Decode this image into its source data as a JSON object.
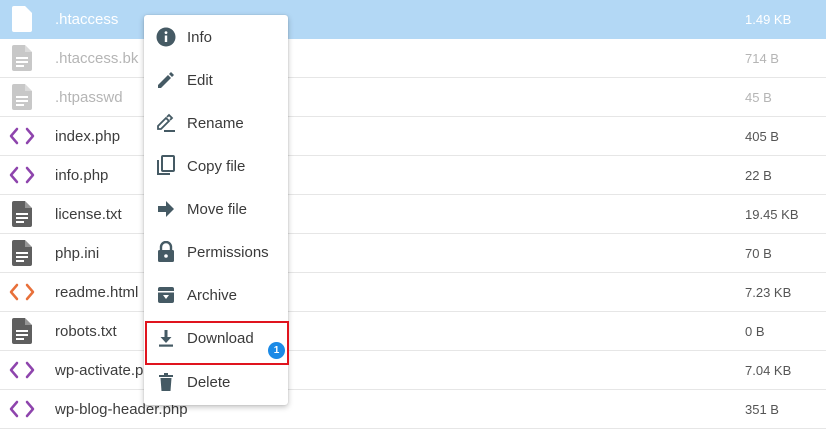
{
  "files": [
    {
      "name": ".htaccess",
      "size": "1.49 KB",
      "icon": "document-icon",
      "state": "selected"
    },
    {
      "name": ".htaccess.bk",
      "size": "714 B",
      "icon": "document-icon",
      "state": "dim"
    },
    {
      "name": ".htpasswd",
      "size": "45 B",
      "icon": "document-icon",
      "state": "dim"
    },
    {
      "name": "index.php",
      "size": "405 B",
      "icon": "code-icon",
      "state": "normal"
    },
    {
      "name": "info.php",
      "size": "22 B",
      "icon": "code-icon",
      "state": "normal"
    },
    {
      "name": "license.txt",
      "size": "19.45 KB",
      "icon": "document-icon",
      "state": "normal"
    },
    {
      "name": "php.ini",
      "size": "70 B",
      "icon": "document-icon",
      "state": "normal"
    },
    {
      "name": "readme.html",
      "size": "7.23 KB",
      "icon": "code-icon",
      "state": "normal"
    },
    {
      "name": "robots.txt",
      "size": "0 B",
      "icon": "document-icon",
      "state": "normal"
    },
    {
      "name": "wp-activate.php",
      "size": "7.04 KB",
      "icon": "code-icon",
      "state": "normal"
    },
    {
      "name": "wp-blog-header.php",
      "size": "351 B",
      "icon": "code-icon",
      "state": "normal"
    }
  ],
  "context_menu": {
    "items": [
      {
        "label": "Info",
        "icon": "info-icon"
      },
      {
        "label": "Edit",
        "icon": "pencil-icon"
      },
      {
        "label": "Rename",
        "icon": "rename-icon"
      },
      {
        "label": "Copy file",
        "icon": "copy-icon"
      },
      {
        "label": "Move file",
        "icon": "arrow-right-icon"
      },
      {
        "label": "Permissions",
        "icon": "lock-icon"
      },
      {
        "label": "Archive",
        "icon": "archive-icon"
      },
      {
        "label": "Download",
        "icon": "download-icon"
      },
      {
        "label": "Delete",
        "icon": "trash-icon"
      }
    ],
    "highlighted_item": "Download",
    "step_badge": "1"
  },
  "colors": {
    "selected_row": "#b3d8f5",
    "php_icon": "#8e44ad",
    "html_icon": "#e8703a",
    "doc_icon": "#5f5f5f",
    "doc_icon_dim": "#c8c8c8",
    "menu_icon": "#455a64",
    "highlight_border": "#e0141e",
    "badge": "#1b8ae6"
  }
}
